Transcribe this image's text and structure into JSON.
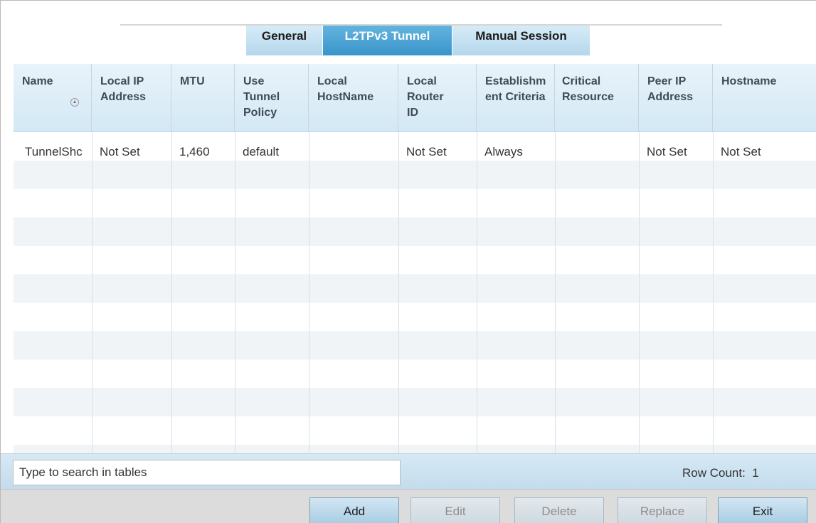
{
  "tabs": [
    {
      "label": "General",
      "active": false
    },
    {
      "label": "L2TPv3 Tunnel",
      "active": true
    },
    {
      "label": "Manual Session",
      "active": false
    }
  ],
  "table": {
    "columns": [
      {
        "key": "name",
        "label": "Name"
      },
      {
        "key": "local_ip",
        "label": "Local IP Address"
      },
      {
        "key": "mtu",
        "label": "MTU"
      },
      {
        "key": "policy",
        "label": "Use Tunnel Policy"
      },
      {
        "key": "local_hostname",
        "label": "Local HostName"
      },
      {
        "key": "router_id",
        "label": "Local Router ID"
      },
      {
        "key": "criteria",
        "label": "Establishment Criteria"
      },
      {
        "key": "critical",
        "label": "Critical Resource"
      },
      {
        "key": "peer_ip",
        "label": "Peer IP Address"
      },
      {
        "key": "hostname",
        "label": "Hostname"
      }
    ],
    "rows": [
      {
        "name": "TunnelShc",
        "local_ip": "Not Set",
        "mtu": "1,460",
        "policy": "default",
        "local_hostname": "",
        "router_id": "Not Set",
        "criteria": "Always",
        "critical": "",
        "peer_ip": "Not Set",
        "hostname": "Not Set"
      }
    ],
    "stripe_color": "#f1f4f6"
  },
  "footer": {
    "search_placeholder": "Type to search in tables",
    "row_count_label": "Row Count:",
    "row_count": "1"
  },
  "actions": [
    {
      "label": "Add",
      "enabled": true
    },
    {
      "label": "Edit",
      "enabled": false
    },
    {
      "label": "Delete",
      "enabled": false
    },
    {
      "label": "Replace",
      "enabled": false
    },
    {
      "label": "Exit",
      "enabled": true
    }
  ],
  "colors": {
    "accent": "#3a94c9",
    "header_bg": "#d3e8f5"
  }
}
